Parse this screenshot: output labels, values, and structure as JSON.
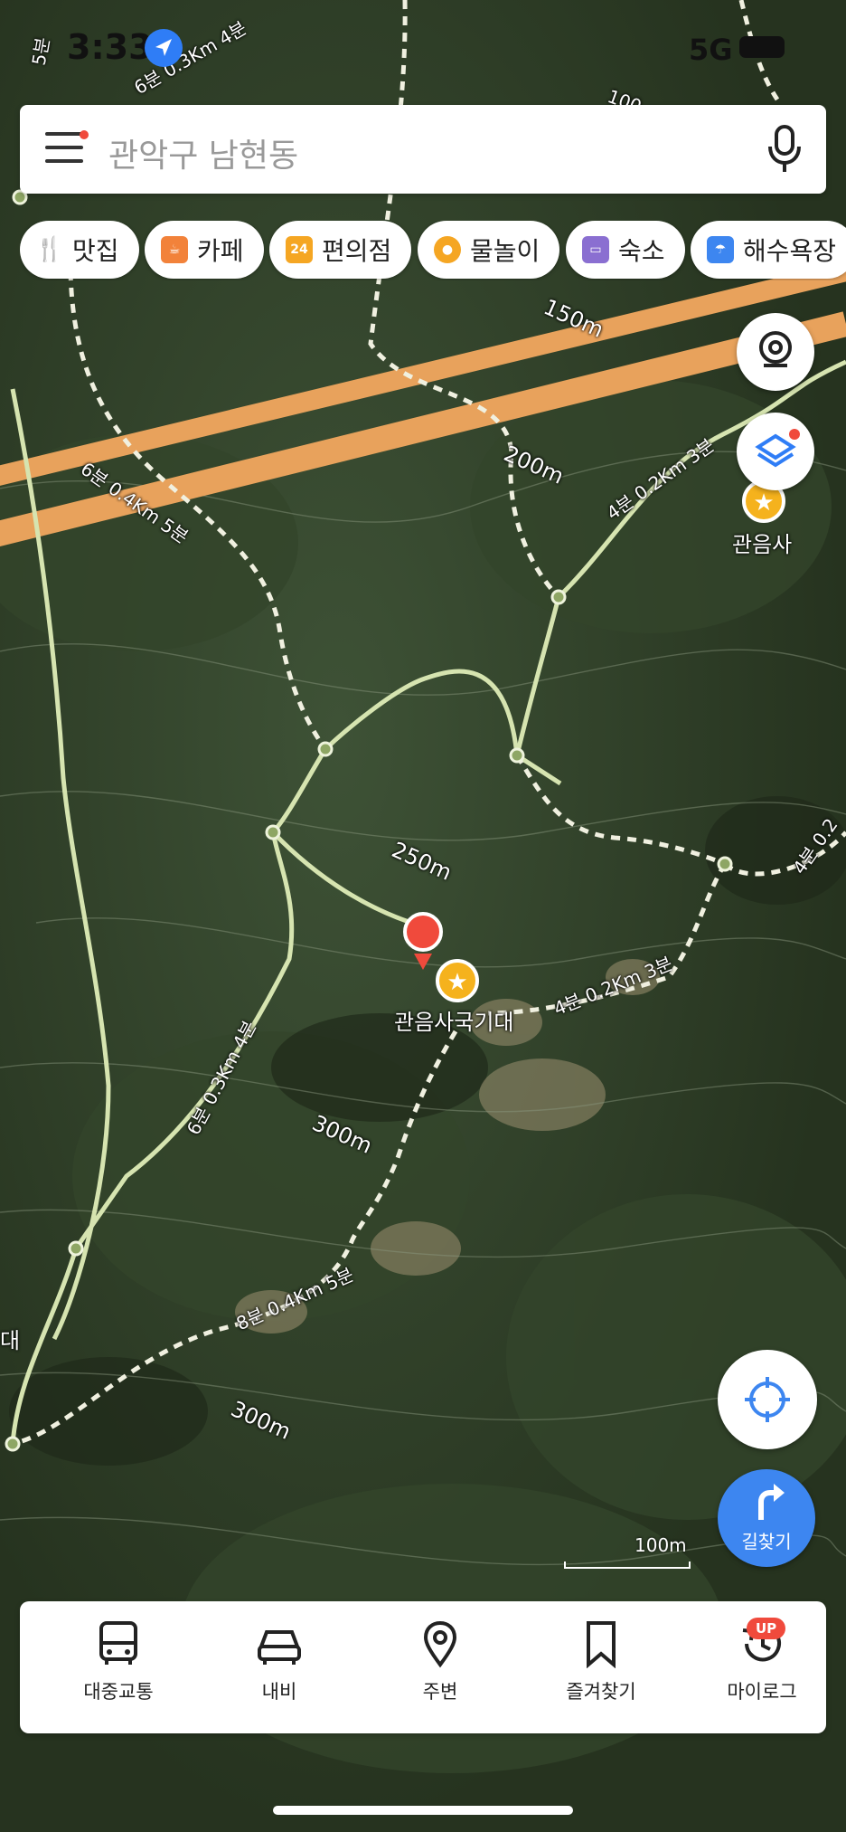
{
  "status_bar": {
    "time": "3:33",
    "network": "5G"
  },
  "search": {
    "placeholder": "관악구 남현동"
  },
  "chips": [
    {
      "label": "맛집",
      "icon": "restaurant-icon",
      "color": "#f2823a"
    },
    {
      "label": "카페",
      "icon": "coffee-icon",
      "color": "#f2823a"
    },
    {
      "label": "편의점",
      "icon": "convenience-store-icon",
      "color": "#f5a623"
    },
    {
      "label": "물놀이",
      "icon": "water-play-icon",
      "color": "#f5a623"
    },
    {
      "label": "숙소",
      "icon": "bed-icon",
      "color": "#8a6fd1"
    },
    {
      "label": "해수욕장",
      "icon": "beach-umbrella-icon",
      "color": "#3d86f0"
    }
  ],
  "map": {
    "places": {
      "temple": "관음사",
      "flag_site": "관음사국기대"
    },
    "contours": {
      "c150": "150m",
      "c200": "200m",
      "c250": "250m",
      "c300a": "300m",
      "c300b": "300m"
    },
    "trail_labels": {
      "t1": "6분 0.4Km 5분",
      "t2": "4분 0.2Km 3분",
      "t3": "4분 0.2Km 3분",
      "t4": "6분 0.3Km 4분",
      "t5": "8분 0.4Km 5분",
      "t6": "6분 0.3Km 4분",
      "t7": "5분",
      "t8": "4분 0.2",
      "t9": "100"
    },
    "edge_text": "대",
    "scale": "100m",
    "route_button": "길찾기"
  },
  "bottom_nav": {
    "items": [
      {
        "label": "대중교통",
        "icon": "bus-icon"
      },
      {
        "label": "내비",
        "icon": "car-icon"
      },
      {
        "label": "주변",
        "icon": "location-pin-icon"
      },
      {
        "label": "즐겨찾기",
        "icon": "bookmark-icon"
      },
      {
        "label": "마이로그",
        "icon": "history-icon"
      }
    ],
    "badge": "UP"
  },
  "colors": {
    "accent": "#3d86f0",
    "marker": "#f04a3c",
    "road": "#e8a25c",
    "trail": "#d6e4b0"
  }
}
